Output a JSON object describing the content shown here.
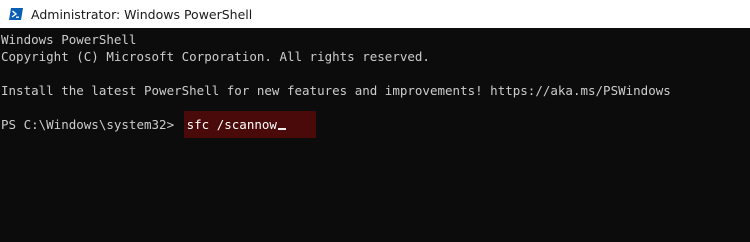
{
  "window": {
    "title": "Administrator: Windows PowerShell",
    "icon": "powershell-icon"
  },
  "console": {
    "lines": [
      "Windows PowerShell",
      "Copyright (C) Microsoft Corporation. All rights reserved.",
      "",
      "Install the latest PowerShell for new features and improvements! https://aka.ms/PSWindows",
      ""
    ],
    "prompt": "PS C:\\Windows\\system32> ",
    "command": "sfc /scannow"
  },
  "colors": {
    "console_background": "#0c0c0c",
    "console_text": "#cccccc",
    "titlebar_background": "#ffffff",
    "command_highlight": "#4a0a0a",
    "powershell_icon": "#0a5fb4"
  }
}
